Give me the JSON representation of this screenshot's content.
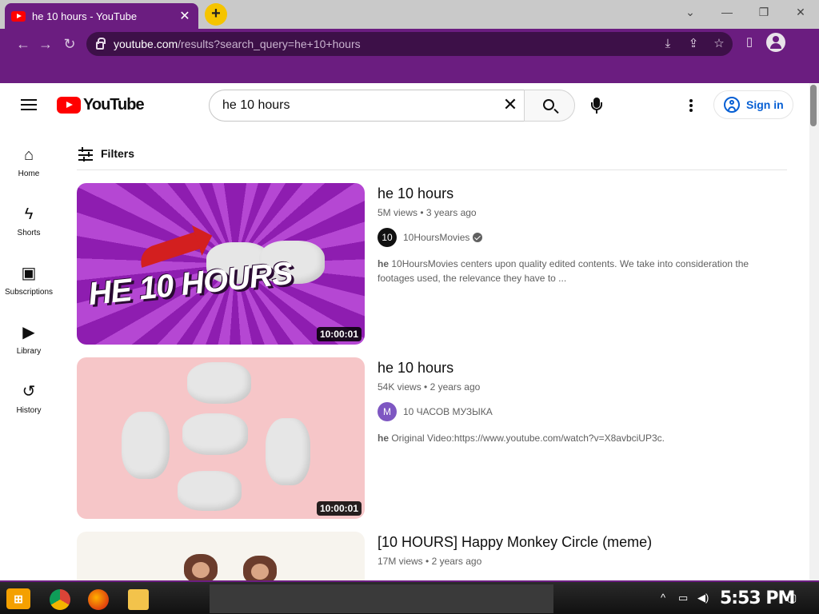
{
  "browser": {
    "tab_title": "he 10 hours - YouTube",
    "tab_close": "✕",
    "new_tab": "+",
    "url_host": "youtube.com",
    "url_path": "/results?search_query=he+10+hours",
    "window_controls": [
      "⌄",
      "—",
      "❐",
      "✕"
    ]
  },
  "header": {
    "logo_text": "YouTube",
    "search_value": "he 10 hours",
    "clear": "✕",
    "signin_label": "Sign in"
  },
  "guide": [
    {
      "label": "Home",
      "icon": "home-icon"
    },
    {
      "label": "Shorts",
      "icon": "shorts-icon"
    },
    {
      "label": "Subscriptions",
      "icon": "subscriptions-icon"
    },
    {
      "label": "Library",
      "icon": "library-icon"
    },
    {
      "label": "History",
      "icon": "history-icon"
    }
  ],
  "filters_label": "Filters",
  "results": [
    {
      "title": "he 10 hours",
      "views": "5M views",
      "age": "3 years ago",
      "channel": "10HoursMovies",
      "verified": true,
      "desc_bold": "he",
      "desc": " 10HoursMovies centers upon quality edited contents. We take into consideration the footages used, the relevance they have to ...",
      "duration": "10:00:01",
      "thumb_text": "HE 10 HOURS",
      "avatar_text": "10"
    },
    {
      "title": "he 10 hours",
      "views": "54K views",
      "age": "2 years ago",
      "channel": "10 ЧАСОВ МУЗЫКА",
      "verified": false,
      "desc_bold": "he",
      "desc": " Original Video:https://www.youtube.com/watch?v=X8avbciUP3c.",
      "duration": "10:00:01",
      "avatar_text": "M"
    },
    {
      "title": "[10 HOURS] Happy Monkey Circle (meme)",
      "views": "17M views",
      "age": "2 years ago"
    }
  ],
  "taskbar": {
    "clock": "5:53 PM"
  },
  "colors": {
    "theme_purple": "#6b1d80",
    "yt_red": "#ff0000",
    "link_blue": "#065fd4"
  }
}
